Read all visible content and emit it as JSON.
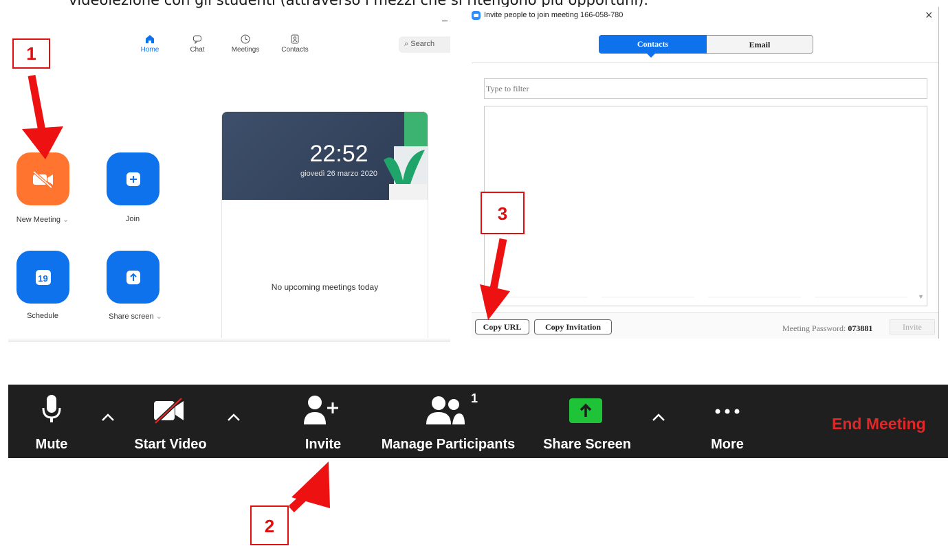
{
  "document": {
    "text": "videolezione con gli studenti (attraverso i mezzi che si ritengono più opportuni)."
  },
  "home": {
    "nav": [
      {
        "label": "Home",
        "icon": "home-icon",
        "active": true
      },
      {
        "label": "Chat",
        "icon": "chat-icon",
        "active": false
      },
      {
        "label": "Meetings",
        "icon": "clock-icon",
        "active": false
      },
      {
        "label": "Contacts",
        "icon": "contacts-icon",
        "active": false
      }
    ],
    "search_label": "Search",
    "actions": {
      "new_meeting": "New Meeting",
      "join": "Join",
      "schedule": "Schedule",
      "share_screen": "Share screen",
      "calendar_day": "19"
    },
    "clock": {
      "time": "22:52",
      "date": "giovedì 26 marzo 2020"
    },
    "no_meetings": "No upcoming meetings today"
  },
  "invite_dialog": {
    "title": "Invite people to join meeting 166-058-780",
    "close": "×",
    "tabs": {
      "contacts": "Contacts",
      "email": "Email"
    },
    "filter_placeholder": "Type to filter",
    "copy_url": "Copy URL",
    "copy_invitation": "Copy Invitation",
    "password_label": "Meeting Password:",
    "password_value": "073881",
    "invite_button": "Invite"
  },
  "toolbar": {
    "mute": "Mute",
    "start_video": "Start Video",
    "invite": "Invite",
    "manage_participants": "Manage Participants",
    "participant_count": "1",
    "share_screen": "Share Screen",
    "more": "More",
    "end_meeting": "End Meeting"
  },
  "annotations": {
    "step1": "1",
    "step2": "2",
    "step3": "3"
  },
  "colors": {
    "zoom_blue": "#0e72ed",
    "new_meeting_orange": "#ff742e",
    "share_green": "#1ec337",
    "end_red": "#e02828",
    "annotation_red": "#e01010"
  }
}
